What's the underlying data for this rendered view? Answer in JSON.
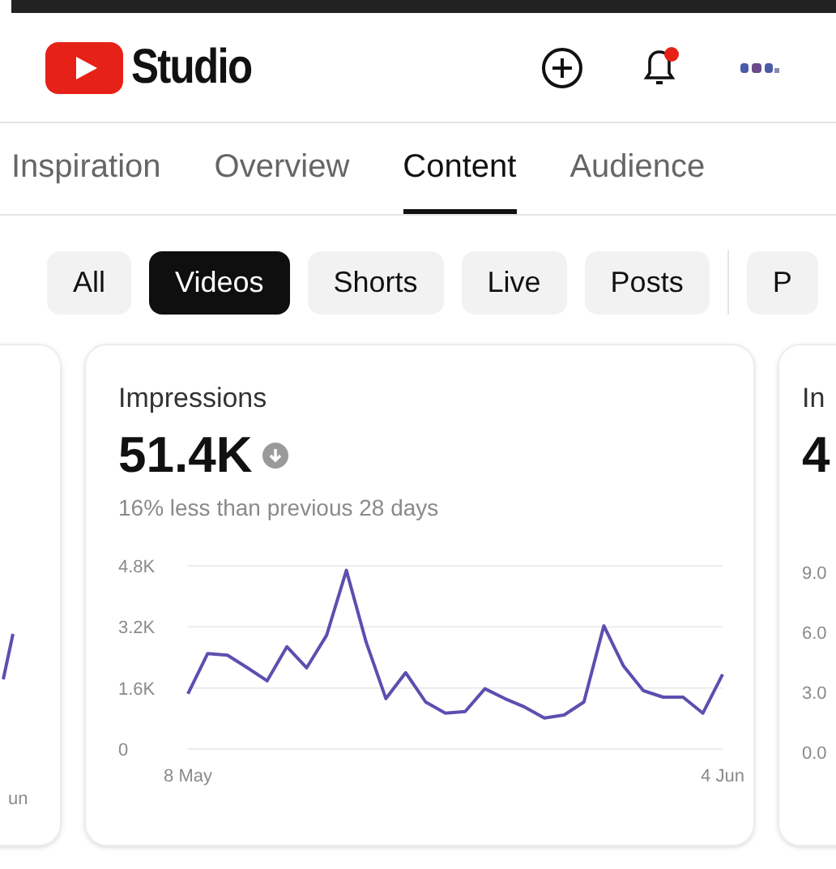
{
  "header": {
    "title": "Studio",
    "notification_dot": true
  },
  "tabs": [
    {
      "label": "Inspiration",
      "selected": false
    },
    {
      "label": "Overview",
      "selected": false
    },
    {
      "label": "Content",
      "selected": true
    },
    {
      "label": "Audience",
      "selected": false
    }
  ],
  "chips": [
    {
      "label": "All",
      "selected": false
    },
    {
      "label": "Videos",
      "selected": true
    },
    {
      "label": "Shorts",
      "selected": false
    },
    {
      "label": "Live",
      "selected": false
    },
    {
      "label": "Posts",
      "selected": false
    },
    {
      "label": "P",
      "selected": false
    }
  ],
  "left_card": {
    "x_label": "un"
  },
  "main_card": {
    "title": "Impressions",
    "value": "51.4K",
    "trend_down": true,
    "comparison": "16% less than previous 28 days",
    "chart_data": {
      "type": "line",
      "categories": [
        "8 May",
        null,
        null,
        null,
        null,
        null,
        null,
        null,
        null,
        null,
        null,
        null,
        null,
        null,
        null,
        null,
        null,
        null,
        null,
        null,
        null,
        null,
        null,
        null,
        null,
        null,
        null,
        "4 Jun"
      ],
      "series": [
        {
          "color": "#5b4fb0",
          "values": [
            1450,
            2500,
            2460,
            2130,
            1790,
            2680,
            2130,
            2980,
            4680,
            2800,
            1320,
            2000,
            1230,
            940,
            980,
            1580,
            1320,
            1100,
            810,
            890,
            1230,
            3230,
            2170,
            1530,
            1360,
            1360,
            940,
            1960
          ]
        }
      ],
      "ylim": [
        0,
        4800
      ],
      "yticks": [
        {
          "value": 0,
          "label": "0"
        },
        {
          "value": 1600,
          "label": "1.6K"
        },
        {
          "value": 3200,
          "label": "3.2K"
        },
        {
          "value": 4800,
          "label": "4.8K"
        }
      ]
    }
  },
  "right_card": {
    "title": "In",
    "value": "4",
    "ticks": [
      "9.0",
      "6.0",
      "3.0",
      "0.0"
    ]
  }
}
